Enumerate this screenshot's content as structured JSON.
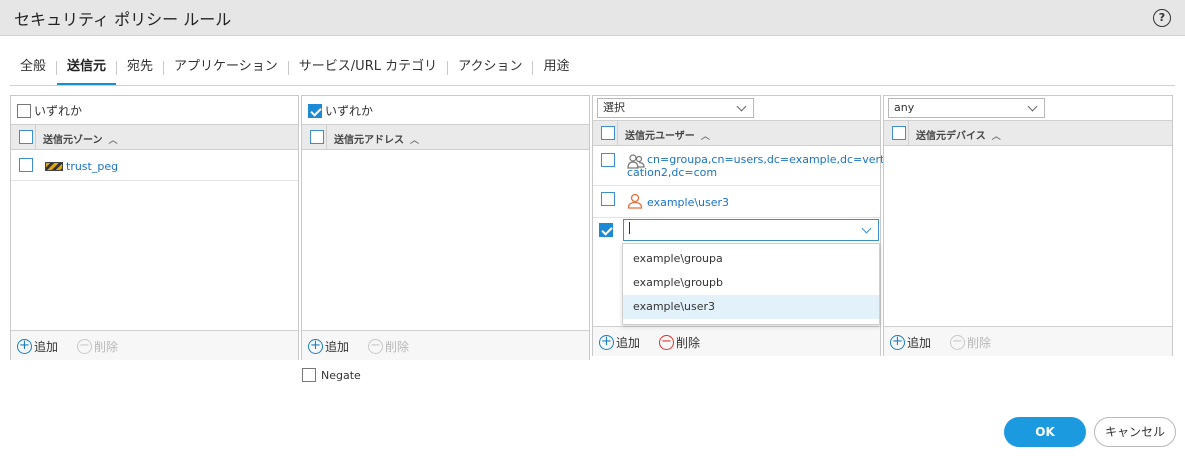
{
  "window": {
    "title": "セキュリティ ポリシー ルール",
    "help_icon": "?"
  },
  "tabs": [
    "全般",
    "送信元",
    "宛先",
    "アプリケーション",
    "サービス/URL カテゴリ",
    "アクション",
    "用途"
  ],
  "active_tab": "送信元",
  "zone_panel": {
    "any_label": "いずれか",
    "any_checked": false,
    "header": "送信元ゾーン",
    "rows": [
      {
        "label": "trust_peg",
        "icon": "zone-icon"
      }
    ],
    "add_label": "追加",
    "delete_label": "削除"
  },
  "address_panel": {
    "any_label": "いずれか",
    "any_checked": true,
    "header": "送信元アドレス",
    "add_label": "追加",
    "delete_label": "削除"
  },
  "user_panel": {
    "select_value": "選択",
    "header": "送信元ユーザー",
    "rows": [
      {
        "line1": "cn=groupa,cn=users,dc=example,dc=vertifi",
        "line2": "cation2,dc=com",
        "icon": "group-icon"
      },
      {
        "label": "example\\user3",
        "icon": "user-icon"
      }
    ],
    "input_value": "",
    "dropdown_options": [
      "example\\groupa",
      "example\\groupb",
      "example\\user3"
    ],
    "highlighted_option": "example\\user3",
    "add_label": "追加",
    "delete_label": "削除"
  },
  "device_panel": {
    "select_value": "any",
    "header": "送信元デバイス",
    "add_label": "追加",
    "delete_label": "削除"
  },
  "negate_label": "Negate",
  "buttons": {
    "ok": "OK",
    "cancel": "キャンセル"
  },
  "colors": {
    "accent": "#1c9ae0",
    "link": "#1a73c8",
    "delete_red": "#d9342b",
    "user_icon": "#e8703a"
  }
}
